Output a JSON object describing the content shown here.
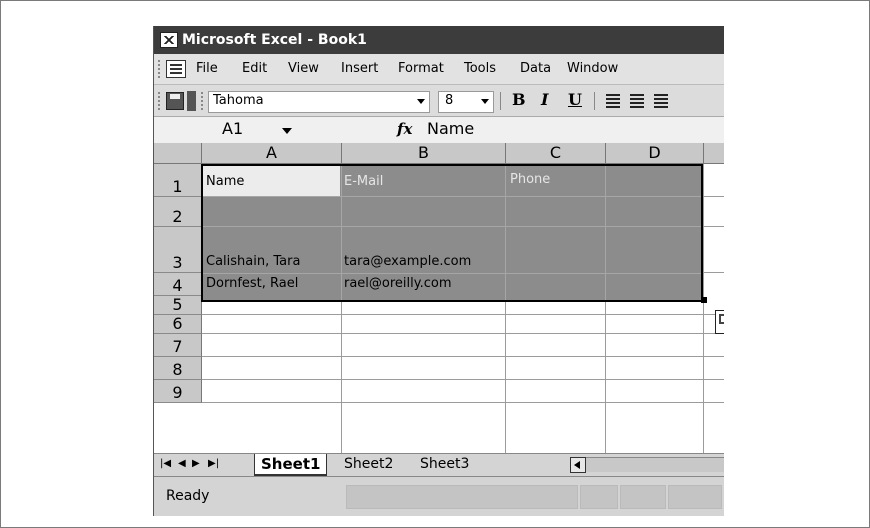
{
  "window": {
    "title": "Microsoft Excel - Book1"
  },
  "menu": {
    "items": [
      {
        "label": "File"
      },
      {
        "label": "Edit"
      },
      {
        "label": "View"
      },
      {
        "label": "Insert"
      },
      {
        "label": "Format"
      },
      {
        "label": "Tools"
      },
      {
        "label": "Data"
      },
      {
        "label": "Window"
      }
    ]
  },
  "toolbar": {
    "font": "Tahoma",
    "size": "8",
    "bold": "B",
    "italic": "I",
    "underline": "U"
  },
  "formula_bar": {
    "name_box": "A1",
    "fx": "fx",
    "value": "Name"
  },
  "grid": {
    "columns": [
      "A",
      "B",
      "C",
      "D"
    ],
    "rows": [
      "1",
      "2",
      "3",
      "4",
      "5",
      "6",
      "7",
      "8",
      "9"
    ],
    "cells": {
      "A1": "Name",
      "B1": "E-Mail",
      "C1": "Phone",
      "A3": "Calishain, Tara",
      "B3": "tara@example.com",
      "A4": "Dornfest, Rael",
      "B4": "rael@oreilly.com"
    }
  },
  "sheets": {
    "tabs": [
      "Sheet1",
      "Sheet2",
      "Sheet3"
    ],
    "active": "Sheet1"
  },
  "status": {
    "text": "Ready"
  }
}
